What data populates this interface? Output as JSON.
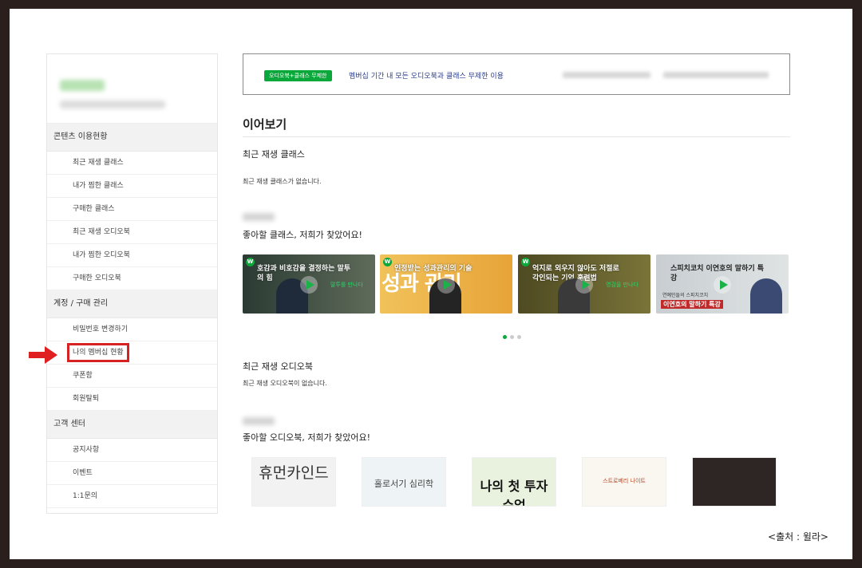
{
  "sidebar": {
    "sections": [
      {
        "title": "콘텐츠 이용현황",
        "items": [
          "최근 재생 클래스",
          "내가 찜한 클래스",
          "구매한 클래스",
          "최근 재생 오디오북",
          "내가 찜한 오디오북",
          "구매한 오디오북"
        ]
      },
      {
        "title": "계정 / 구매 관리",
        "items": [
          "비밀번호 변경하기",
          "나의 멤버십 현황",
          "쿠폰함",
          "회원탈퇴"
        ]
      },
      {
        "title": "고객 센터",
        "items": [
          "공지사항",
          "이벤트",
          "1:1문의"
        ]
      }
    ]
  },
  "banner": {
    "badge": "오디오북+클래스 무제한",
    "text": "멤버십 기간 내 모든 오디오북과 클래스 무제한 이용"
  },
  "main": {
    "title": "이어보기",
    "recent_class_heading": "최근 재생 클래스",
    "recent_class_empty": "최근 재생 클래스가 없습니다.",
    "class_rec_heading": "좋아할 클래스, 저희가 찾았어요!",
    "recent_audio_heading": "최근 재생 오디오북",
    "recent_audio_empty": "최근 재생 오디오북이 없습니다.",
    "audio_rec_heading": "좋아할 오디오북, 저희가 찾았어요!"
  },
  "class_cards": [
    {
      "title": "호감과 비호감을 결정하는 말투의 힘",
      "side": "말투를 만나다",
      "accent": "#3a4a3a"
    },
    {
      "title": "인정받는 성과관리의 기술",
      "big": "성과 관리",
      "accent": "#e5a33a"
    },
    {
      "title": "억지로 외우지 않아도 저절로 각인되는 기억 훈련법",
      "side": "영감을 만나다",
      "accent": "#5b5a2a"
    },
    {
      "title": "스피치코치 이연호의 말하기 특강",
      "tag": "이연호의 말하기 특강",
      "sub": "연예인들의 스피치코치",
      "accent": "#cfd4d6"
    }
  ],
  "carousel": {
    "pages": 3,
    "active": 0
  },
  "books": [
    {
      "title": "휴먼카인드",
      "bg": "#f2f2f2"
    },
    {
      "title": "홀로서기 심리학",
      "bg": "#eef3f5"
    },
    {
      "title": "나의 첫 투자 수업",
      "bg": "#e9f2de"
    },
    {
      "title": "스트로베리 나이트",
      "bg": "#faf7f0"
    },
    {
      "title": "",
      "bg": "#2e2624"
    }
  ],
  "caption": "<출처 : 윌라>",
  "colors": {
    "accent": "#0aa83a",
    "highlight": "#d62222",
    "link": "#2b3e8a"
  }
}
